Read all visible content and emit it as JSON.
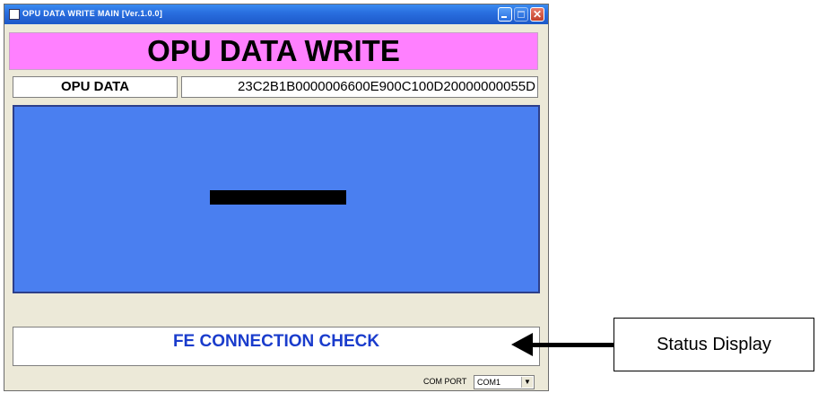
{
  "window": {
    "title": "OPU DATA WRITE MAIN [Ver.1.0.0]"
  },
  "banner": {
    "title": "OPU DATA WRITE"
  },
  "opu_data": {
    "label": "OPU DATA",
    "value": "23C2B1B0000006600E900C100D20000000055D"
  },
  "status": {
    "text": "FE CONNECTION CHECK"
  },
  "com_port": {
    "label": "COM PORT",
    "selected": "COM1"
  },
  "callout": {
    "text": "Status Display"
  },
  "colors": {
    "banner_bg": "#ff80ff",
    "panel_bg": "#4a7ff0",
    "status_text": "#1a3ccc"
  }
}
